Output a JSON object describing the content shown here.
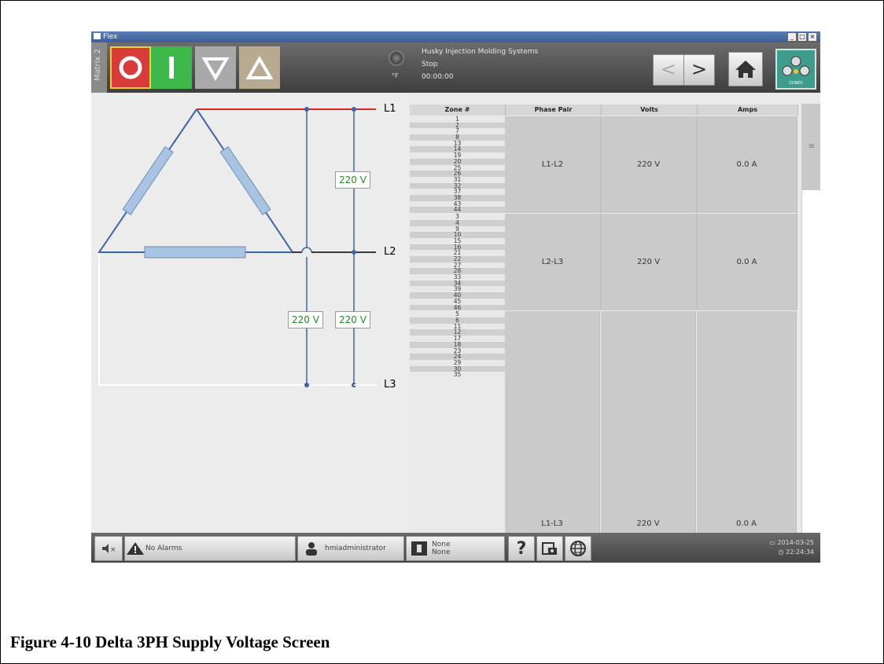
{
  "window": {
    "title": "Flex",
    "min": "_",
    "max": "□",
    "close": "×"
  },
  "toolbar": {
    "matrix_label": "Matrix 2",
    "temp_unit": "°F",
    "company": "Husky Injection Molding Systems",
    "state": "Stop",
    "time": "00:00:00",
    "zones_badge": "ZONES",
    "nav_back": "<",
    "nav_fwd": ">"
  },
  "diagram": {
    "lines": [
      "L1",
      "L2",
      "L3"
    ],
    "voltage_labels": [
      "220 V",
      "220 V",
      "220 V"
    ],
    "colors": {
      "l1": "#dd2222",
      "phase": "#3a66a8",
      "resistor": "#a8c4e2"
    }
  },
  "table": {
    "headers": [
      "Zone #",
      "Phase Pair",
      "Volts",
      "Amps"
    ],
    "groups": [
      {
        "zones": [
          "1",
          "2",
          "7",
          "8",
          "13",
          "14",
          "19",
          "20",
          "25",
          "26",
          "31",
          "32",
          "37",
          "38",
          "43",
          "44"
        ],
        "pair": "L1-L2",
        "volts": "220 V",
        "amps": "0.0 A"
      },
      {
        "zones": [
          "3",
          "4",
          "9",
          "10",
          "15",
          "16",
          "21",
          "22",
          "27",
          "28",
          "33",
          "34",
          "39",
          "40",
          "45",
          "46"
        ],
        "pair": "L2-L3",
        "volts": "220 V",
        "amps": "0.0 A"
      },
      {
        "zones": [
          "5",
          "6",
          "11",
          "12",
          "17",
          "18",
          "23",
          "24",
          "29",
          "30",
          "35"
        ],
        "pair": "L1-L3",
        "volts": "220 V",
        "amps": "0.0 A"
      }
    ]
  },
  "statusbar": {
    "alarms": "No Alarms",
    "user": "hmiadministrator",
    "mold_line1": "None",
    "mold_line2": "None",
    "help": "?",
    "date": "2014-03-25",
    "clock": "22:24:34"
  },
  "caption": "Figure 4-10 Delta 3PH Supply Voltage Screen"
}
